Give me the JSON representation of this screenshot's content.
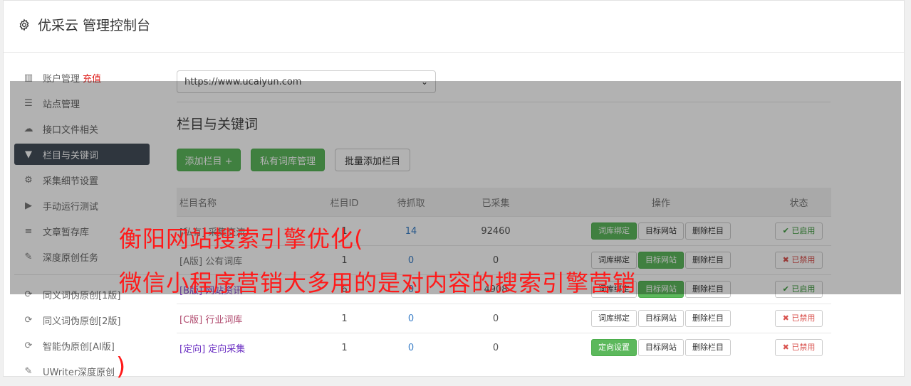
{
  "header": {
    "title": "优采云 管理控制台",
    "icon": "gear-icon"
  },
  "sidebar": {
    "items": [
      {
        "label": "账户管理",
        "extra": "充值",
        "icon": "bar-chart-icon",
        "glyph": "▥"
      },
      {
        "label": "站点管理",
        "icon": "server-icon",
        "glyph": "☰"
      },
      {
        "label": "接口文件相关",
        "icon": "cloud-upload-icon",
        "glyph": "☁"
      },
      {
        "label": "栏目与关键词",
        "icon": "filter-icon",
        "glyph": "▼",
        "active": true
      },
      {
        "label": "采集细节设置",
        "icon": "cogs-icon",
        "glyph": "⚙"
      },
      {
        "label": "手动运行测试",
        "icon": "play-circle-icon",
        "glyph": "▶"
      },
      {
        "label": "文章暂存库",
        "icon": "database-icon",
        "glyph": "≡"
      },
      {
        "label": "深度原创任务",
        "icon": "edit-icon",
        "glyph": "✎"
      }
    ],
    "items2": [
      {
        "label": "同义词伪原创[1版]",
        "icon": "refresh-icon",
        "glyph": "⟳"
      },
      {
        "label": "同义词伪原创[2版]",
        "icon": "refresh-icon",
        "glyph": "⟳"
      },
      {
        "label": "智能伪原创[AI版]",
        "icon": "refresh-icon",
        "glyph": "⟳"
      },
      {
        "label": "UWriter深度原创",
        "icon": "edit-icon",
        "glyph": "✎"
      }
    ]
  },
  "site_select": {
    "value": "https://www.ucaiyun.com"
  },
  "section": {
    "title": "栏目与关键词"
  },
  "toolbar": {
    "add": "添加栏目 +",
    "private": "私有词库管理",
    "batch": "批量添加栏目"
  },
  "table": {
    "headers": {
      "name": "栏目名称",
      "id": "栏目ID",
      "pending": "待抓取",
      "collected": "已采集",
      "ops": "操作",
      "state": "状态"
    },
    "rows": [
      {
        "tag": "[私有]",
        "name": "采集交流",
        "id": "1",
        "pending": "14",
        "collected": "92460",
        "op1": "词库绑定",
        "op1_green": true,
        "op2": "目标网站",
        "op2_green": false,
        "op3": "删除栏目",
        "state": "已启用",
        "state_on": true
      },
      {
        "tag": "[A版]",
        "name": "公有词库",
        "id": "1",
        "pending": "0",
        "collected": "0",
        "op1": "词库绑定",
        "op1_green": false,
        "op2": "目标网站",
        "op2_green": true,
        "op3": "删除栏目",
        "state": "已禁用",
        "state_on": false
      },
      {
        "tag": "[B版]",
        "name": "网站资讯",
        "id": "6",
        "pending": "0",
        "collected": "4908",
        "op1": "词库绑定",
        "op1_green": false,
        "op2": "目标网站",
        "op2_green": true,
        "op3": "删除栏目",
        "state": "已启用",
        "state_on": true
      },
      {
        "tag": "[C版]",
        "name": "行业词库",
        "id": "1",
        "pending": "0",
        "collected": "0",
        "op1": "词库绑定",
        "op1_green": false,
        "op2": "目标网站",
        "op2_green": false,
        "op3": "删除栏目",
        "state": "已禁用",
        "state_on": false
      },
      {
        "tag": "[定向]",
        "name": "定向采集",
        "id": "1",
        "pending": "0",
        "collected": "0",
        "op1": "定向设置",
        "op1_green": true,
        "op2": "目标网站",
        "op2_green": false,
        "op3": "删除栏目",
        "state": "已禁用",
        "state_on": false
      }
    ]
  },
  "overlay": {
    "line1": "衡阳网站搜索引擎优化(",
    "line2": "微信小程序营销大多用的是对内容的搜索引擎营销",
    "close_paren": ")"
  },
  "colors": {
    "accent_green": "#5cb85c",
    "active_sidebar": "#444e5a",
    "overlay_text": "#ff1a1a"
  }
}
